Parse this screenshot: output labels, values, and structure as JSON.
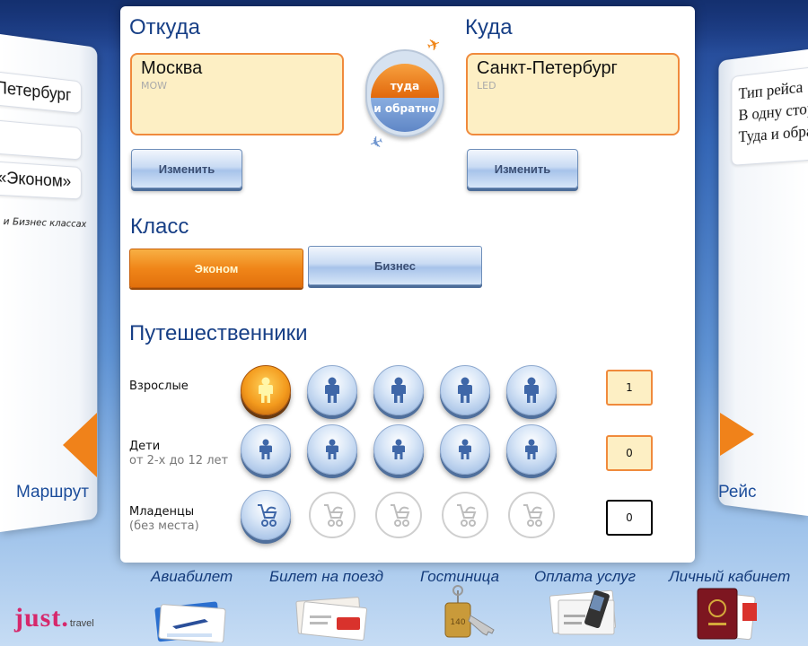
{
  "left_panel": {
    "items": [
      "Петербург",
      "",
      "«Эконом»"
    ],
    "note": "м и Бизнес классах",
    "nav_label": "Маршрут"
  },
  "right_panel": {
    "lines": [
      "Тип рейса",
      "В одну стор",
      "Туда и обра"
    ],
    "nav_label": "Рейс"
  },
  "from": {
    "heading": "Откуда",
    "city": "Москва",
    "code": "MOW",
    "button": "Изменить"
  },
  "to": {
    "heading": "Куда",
    "city": "Санкт-Петербург",
    "code": "LED",
    "button": "Изменить"
  },
  "trip_type": {
    "top": "туда",
    "bottom": "и обратно"
  },
  "travel_class": {
    "heading": "Класс",
    "options": [
      "Эконом",
      "Бизнес"
    ],
    "selected": "Эконом"
  },
  "travelers": {
    "heading": "Путешественники",
    "adults": {
      "label": "Взрослые",
      "sub": "",
      "count": "1"
    },
    "children": {
      "label": "Дети",
      "sub": "от 2-х до 12 лет",
      "count": "0"
    },
    "infants": {
      "label": "Младенцы",
      "sub": "(без места)",
      "count": "0"
    }
  },
  "bottom_nav": {
    "items": [
      "Авиабилет",
      "Билет на поезд",
      "Гостиница",
      "Оплата услуг",
      "Личный кабинет"
    ]
  },
  "brand": {
    "name": "just.",
    "suffix": "travel"
  },
  "colors": {
    "accent_orange": "#f08619",
    "heading_blue": "#173f86",
    "field_fill": "#fdefc4"
  }
}
